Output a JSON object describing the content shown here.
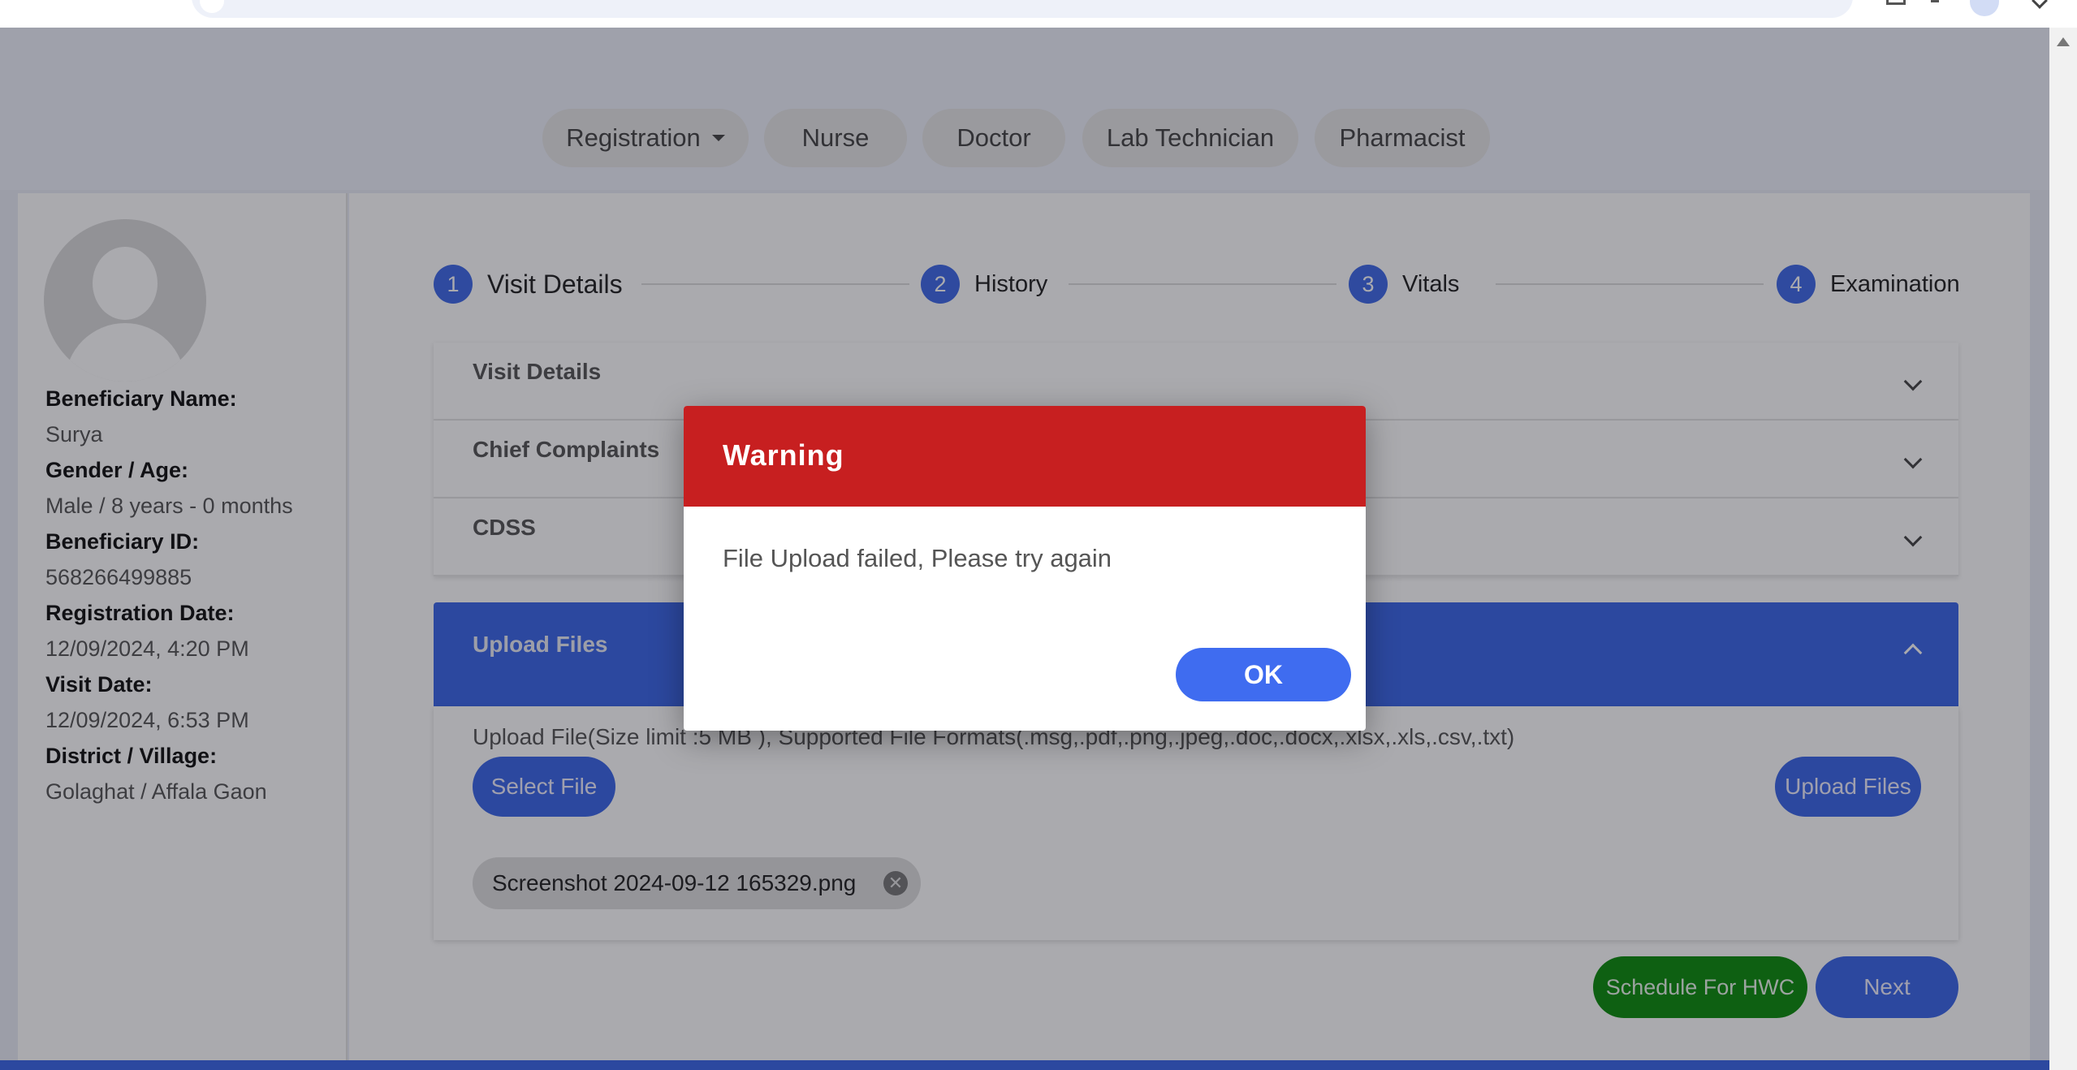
{
  "nav": {
    "registration": "Registration",
    "nurse": "Nurse",
    "doctor": "Doctor",
    "lab_technician": "Lab Technician",
    "pharmacist": "Pharmacist"
  },
  "beneficiary": {
    "name_label": "Beneficiary Name:",
    "name": "Surya",
    "gender_age_label": "Gender / Age:",
    "gender_age": "Male / 8 years - 0 months",
    "id_label": "Beneficiary ID:",
    "id": "568266499885",
    "registration_date_label": "Registration Date:",
    "registration_date": "12/09/2024, 4:20 PM",
    "visit_date_label": "Visit Date:",
    "visit_date": "12/09/2024, 6:53 PM",
    "district_village_label": "District / Village:",
    "district_village": "Golaghat / Affala Gaon"
  },
  "stepper": [
    {
      "number": "1",
      "label": "Visit Details"
    },
    {
      "number": "2",
      "label": "History"
    },
    {
      "number": "3",
      "label": "Vitals"
    },
    {
      "number": "4",
      "label": "Examination"
    }
  ],
  "accordions": {
    "visit_details": "Visit Details",
    "chief_complaints": "Chief Complaints",
    "cdss": "CDSS"
  },
  "upload": {
    "title": "Upload Files",
    "hint": "Upload File(Size limit :5 MB ), Supported File Formats(.msg,.pdf,.png,.jpeg,.doc,.docx,.xlsx,.xls,.csv,.txt)",
    "select_file": "Select File",
    "upload_files": "Upload Files",
    "file_name": "Screenshot 2024-09-12 165329.png",
    "remove_glyph": "✕"
  },
  "actions": {
    "schedule": "Schedule For HWC",
    "next": "Next"
  },
  "dialog": {
    "title": "Warning",
    "message": "File Upload failed, Please try again",
    "ok": "OK"
  },
  "colors": {
    "primary": "#3a66e8",
    "warning_header": "#c71f20",
    "schedule_green": "#0b8c0b"
  }
}
